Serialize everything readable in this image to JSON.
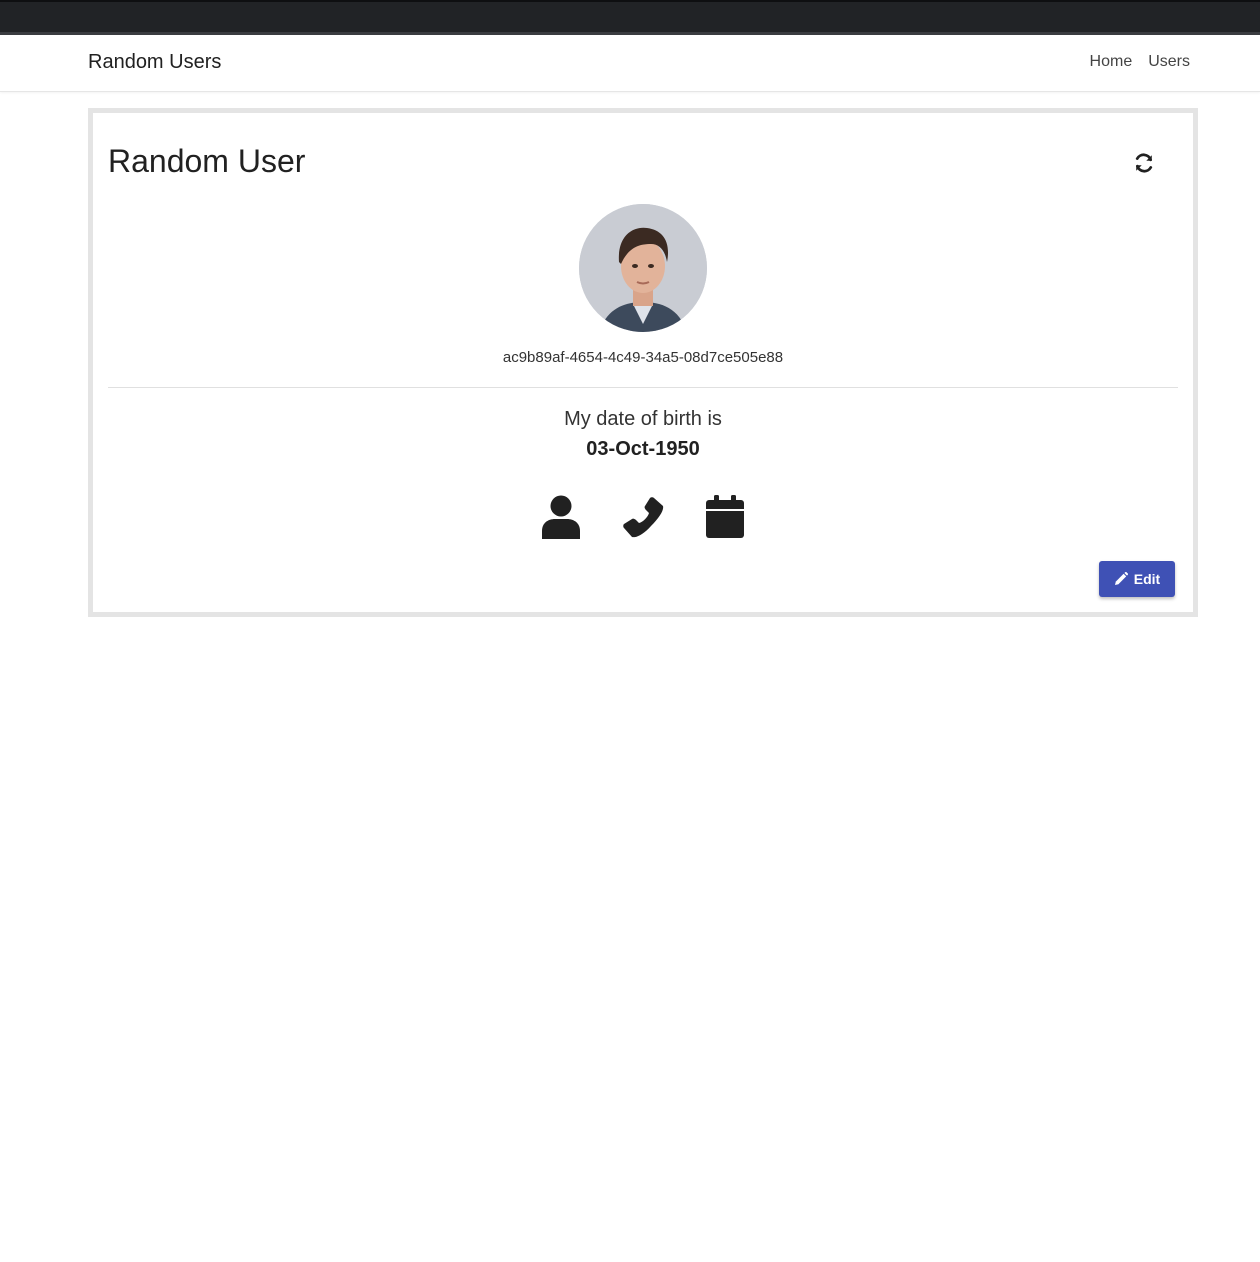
{
  "navbar": {
    "brand": "Random Users",
    "links": [
      "Home",
      "Users"
    ]
  },
  "card": {
    "title": "Random User",
    "refresh_icon": "refresh-icon",
    "avatar_icon": "user-avatar-photo",
    "user_id": "ac9b89af-4654-4c49-34a5-08d7ce505e88",
    "dob_label": "My date of birth is",
    "dob_value": "03-Oct-1950",
    "info_icons": [
      "person-icon",
      "phone-icon",
      "calendar-icon"
    ],
    "edit_label": "Edit",
    "edit_icon": "pencil-icon"
  },
  "colors": {
    "primary": "#3f51b5",
    "topbar": "#212326",
    "text": "#212121",
    "card_border": "#e4e4e4"
  }
}
